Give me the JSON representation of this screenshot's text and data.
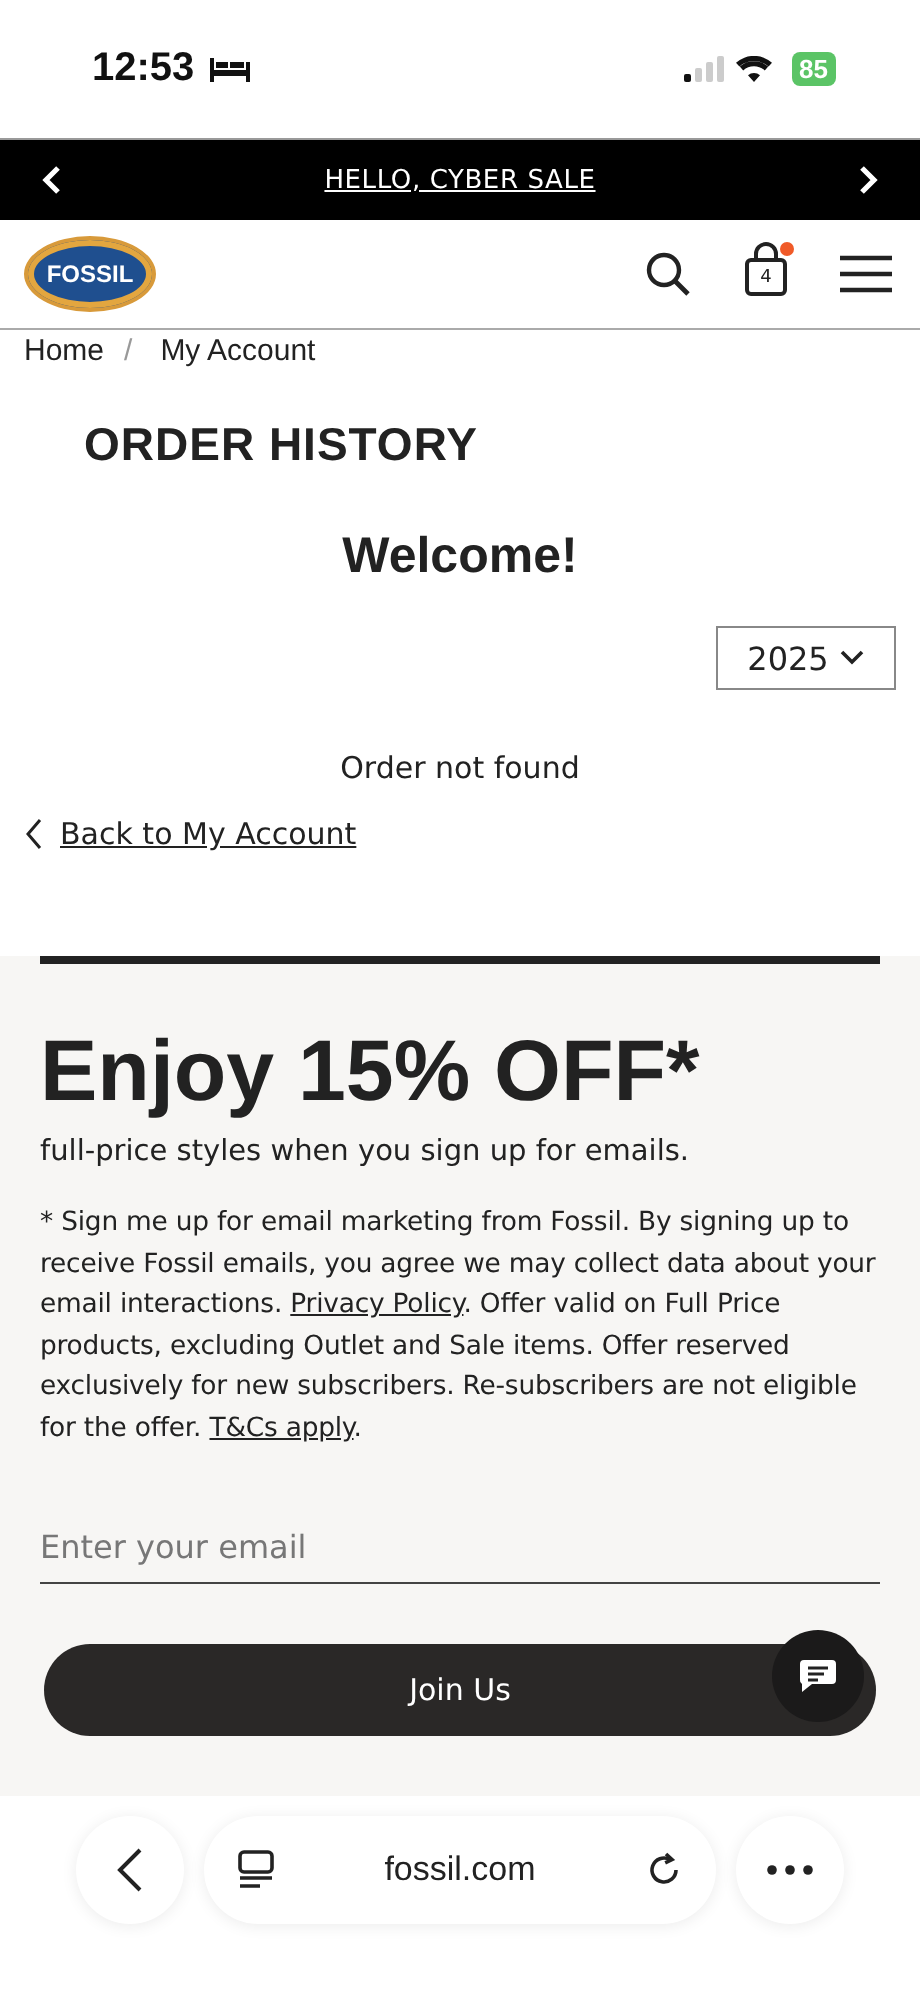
{
  "status_bar": {
    "time": "12:53",
    "battery": "85"
  },
  "promo_banner": {
    "text": "HELLO, CYBER SALE"
  },
  "header": {
    "logo_text": "FOSSIL",
    "cart_count": "4"
  },
  "breadcrumb": [
    {
      "label": "Home"
    },
    {
      "label": "My Account"
    }
  ],
  "breadcrumb_separator": "/",
  "page_title": "ORDER HISTORY",
  "welcome": "Welcome!",
  "year_select": {
    "value": "2025"
  },
  "message": "Order not found",
  "back_link": "Back to My Account",
  "signup": {
    "headline": "Enjoy 15% OFF*",
    "subtitle": "full-price styles when you sign up for emails.",
    "legal": [
      {
        "kind": "text",
        "text": "* Sign me up for email marketing from Fossil. By signing up to receive Fossil emails, you agree we may collect data about your email interactions. "
      },
      {
        "kind": "link",
        "text": "Privacy Policy"
      },
      {
        "kind": "text",
        "text": ". Offer valid on Full Price products, excluding Outlet and Sale items. Offer reserved exclusively for new subscribers. Re-subscribers are not eligible for the offer. "
      },
      {
        "kind": "link",
        "text": "T&Cs apply"
      },
      {
        "kind": "text",
        "text": "."
      }
    ],
    "email_placeholder": "Enter your email",
    "button": "Join Us"
  },
  "browser_bar": {
    "url": "fossil.com"
  }
}
